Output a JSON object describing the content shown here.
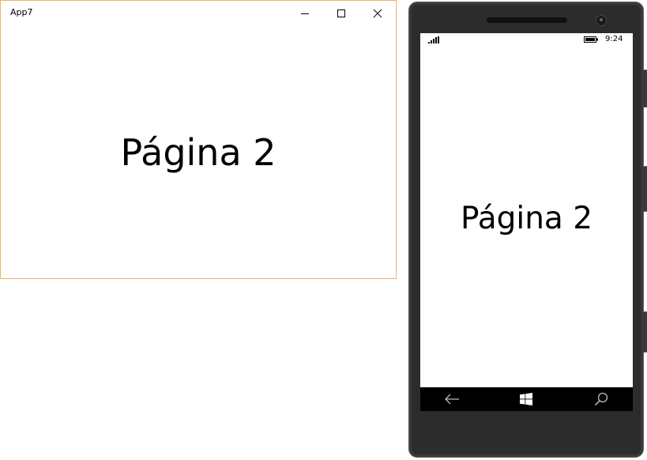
{
  "window": {
    "title": "App7",
    "page_text": "Página 2",
    "border_color": "#f0b366",
    "buttons": {
      "minimize_icon": "minimize-icon",
      "maximize_icon": "maximize-icon",
      "close_icon": "close-icon"
    }
  },
  "phone": {
    "status_bar": {
      "time": "9:24",
      "signal_icon": "signal-strength-icon",
      "battery_icon": "battery-icon"
    },
    "page_text": "Página 2",
    "nav_bar": {
      "back_icon": "back-arrow-icon",
      "start_icon": "windows-logo-icon",
      "search_icon": "search-icon"
    }
  }
}
